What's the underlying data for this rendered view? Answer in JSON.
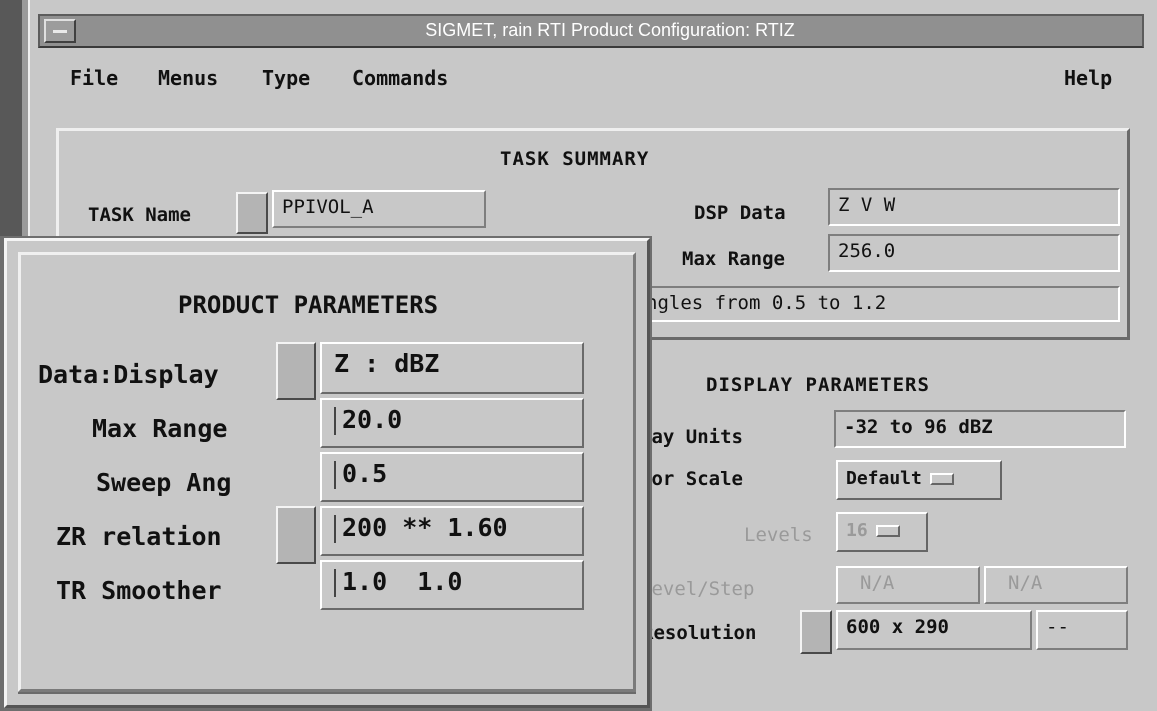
{
  "window": {
    "title": "SIGMET, rain  RTI Product Configuration: RTIZ"
  },
  "menubar": {
    "file": "File",
    "menus": "Menus",
    "type": "Type",
    "commands": "Commands",
    "help": "Help"
  },
  "task_summary": {
    "heading": "TASK SUMMARY",
    "task_name_label": "TASK Name",
    "task_name_value": "PPIVOL_A",
    "dsp_data_label": "DSP Data",
    "dsp_data_value": "Z V W",
    "max_range_label": "Max Range",
    "max_range_value": "256.0",
    "angles_text": "ngles from 0.5 to 1.2"
  },
  "display_parameters": {
    "heading": "DISPLAY PARAMETERS",
    "units_label": "lay Units",
    "units_value": "-32 to 96 dBZ",
    "color_scale_label": "lor Scale",
    "color_scale_value": "Default",
    "levels_label": "Levels",
    "levels_value": "16",
    "level_step_label": "Level/Step",
    "level_value": "N/A",
    "step_value": "N/A",
    "resolution_label": "Resolution",
    "resolution_value": "600 x 290",
    "resolution_extra": "--"
  },
  "product_parameters": {
    "heading": "PRODUCT PARAMETERS",
    "data_display_label": "Data:Display",
    "data_display_value": "Z : dBZ",
    "max_range_label": "Max Range",
    "max_range_value": "20.0",
    "sweep_ang_label": "Sweep Ang",
    "sweep_ang_value": "0.5",
    "zr_label": "ZR relation",
    "zr_value": "200 ** 1.60",
    "tr_label": "TR Smoother",
    "tr_value": "1.0  1.0"
  }
}
